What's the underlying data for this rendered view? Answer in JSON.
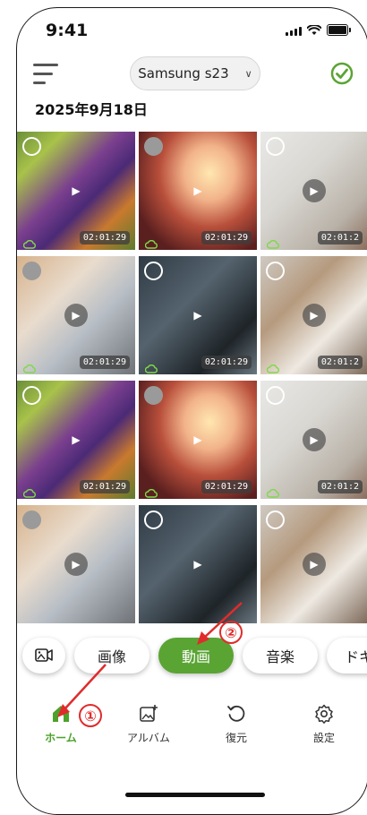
{
  "status_bar": {
    "time": "9:41"
  },
  "header": {
    "device_name": "Samsung s23",
    "date": "2025年9月18日"
  },
  "grid_rows": [
    [
      {
        "kind": "musician",
        "duration": "02:01:29",
        "selected_style": "outline"
      },
      {
        "kind": "crowd",
        "duration": "02:01:29",
        "selected_style": "filled"
      },
      {
        "kind": "doc",
        "duration": "02:01:2",
        "selected_style": "outline"
      }
    ],
    [
      {
        "kind": "laptop",
        "duration": "02:01:29",
        "selected_style": "filled"
      },
      {
        "kind": "meeting",
        "duration": "02:01:29",
        "selected_style": "outline"
      },
      {
        "kind": "thumbsup",
        "duration": "02:01:2",
        "selected_style": "outline"
      }
    ],
    [
      {
        "kind": "musician",
        "duration": "02:01:29",
        "selected_style": "outline"
      },
      {
        "kind": "crowd",
        "duration": "02:01:29",
        "selected_style": "filled"
      },
      {
        "kind": "doc",
        "duration": "02:01:2",
        "selected_style": "outline"
      }
    ],
    [
      {
        "kind": "laptop",
        "duration": "",
        "selected_style": "filled"
      },
      {
        "kind": "meeting",
        "duration": "",
        "selected_style": "outline"
      },
      {
        "kind": "thumbsup",
        "duration": "",
        "selected_style": "outline"
      }
    ]
  ],
  "filter_chips": [
    {
      "label": "",
      "icon": "video-image-icon"
    },
    {
      "label": "画像"
    },
    {
      "label": "動画",
      "active": true
    },
    {
      "label": "音楽"
    },
    {
      "label": "ドキ"
    }
  ],
  "tabs": [
    {
      "label": "ホーム",
      "icon": "home-icon",
      "active": true
    },
    {
      "label": "アルバム",
      "icon": "album-add-icon"
    },
    {
      "label": "復元",
      "icon": "restore-icon"
    },
    {
      "label": "設定",
      "icon": "gear-icon"
    }
  ],
  "annotations": [
    {
      "number": "①"
    },
    {
      "number": "②"
    }
  ],
  "colors": {
    "accent": "#5aa434",
    "annotation": "#e02b2b"
  }
}
